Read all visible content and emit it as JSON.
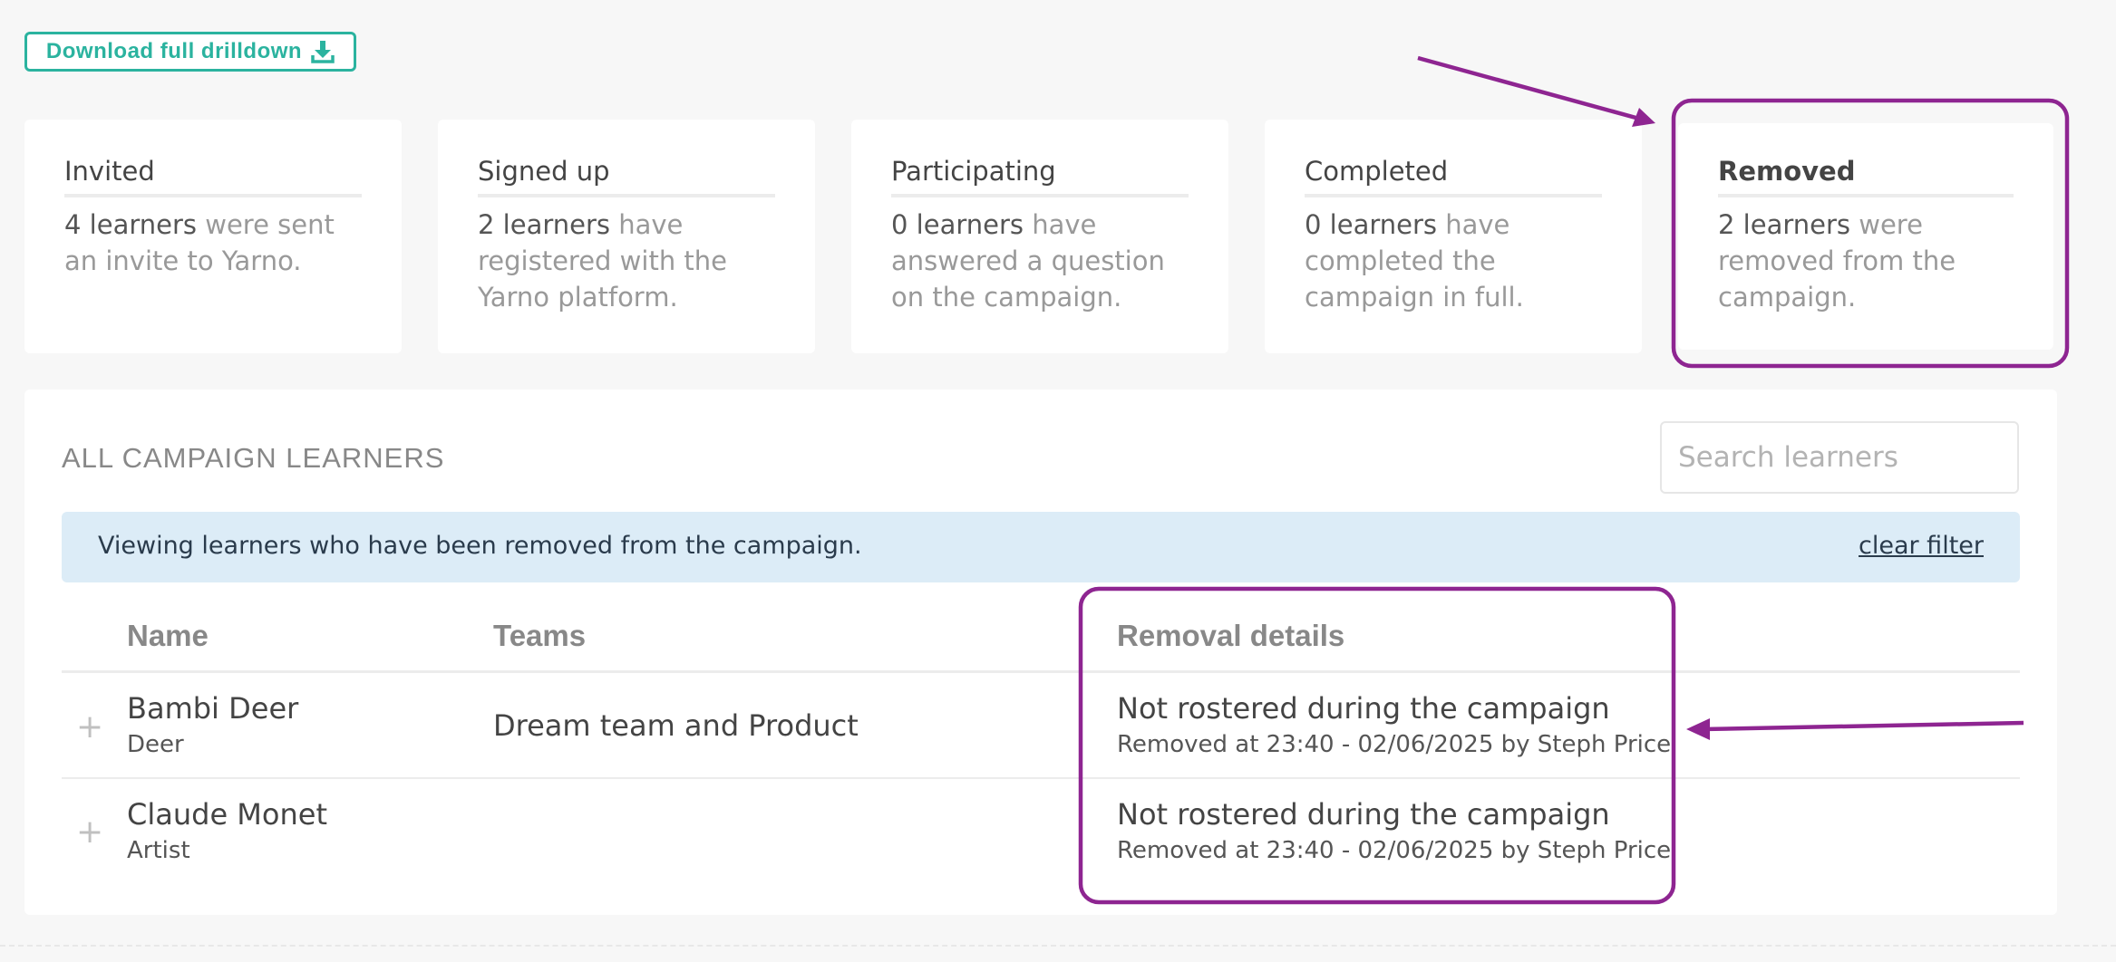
{
  "toolbar": {
    "download_label": "Download full drilldown",
    "download_icon": "download-icon"
  },
  "cards": [
    {
      "title": "Invited",
      "count": "4 learners",
      "desc": " were sent an invite to Yarno."
    },
    {
      "title": "Signed up",
      "count": "2 learners",
      "desc": " have registered with the Yarno platform."
    },
    {
      "title": "Participating",
      "count": "0 learners",
      "desc": " have answered a question on the campaign."
    },
    {
      "title": "Completed",
      "count": "0 learners",
      "desc": " have completed the campaign in full."
    },
    {
      "title": "Removed",
      "count": "2 learners",
      "desc": " were removed from the campaign."
    }
  ],
  "learners": {
    "title": "ALL CAMPAIGN LEARNERS",
    "search_placeholder": "Search learners",
    "filter_message": "Viewing learners who have been removed from the campaign.",
    "clear_filter": "clear filter",
    "columns": {
      "name": "Name",
      "teams": "Teams",
      "removal": "Removal details"
    },
    "rows": [
      {
        "name": "Bambi Deer",
        "subtitle": "Deer",
        "teams": "Dream team and Product",
        "reason": "Not rostered during the campaign",
        "detail": "Removed at 23:40 - 02/06/2025 by Steph Price"
      },
      {
        "name": "Claude Monet",
        "subtitle": "Artist",
        "teams": "",
        "reason": "Not rostered during the campaign",
        "detail": "Removed at 23:40 - 02/06/2025 by Steph Price"
      }
    ],
    "expand_symbol": "+"
  },
  "colors": {
    "accent": "#2bb39f",
    "annotation": "#8e2591",
    "banner": "#dcecf7"
  }
}
